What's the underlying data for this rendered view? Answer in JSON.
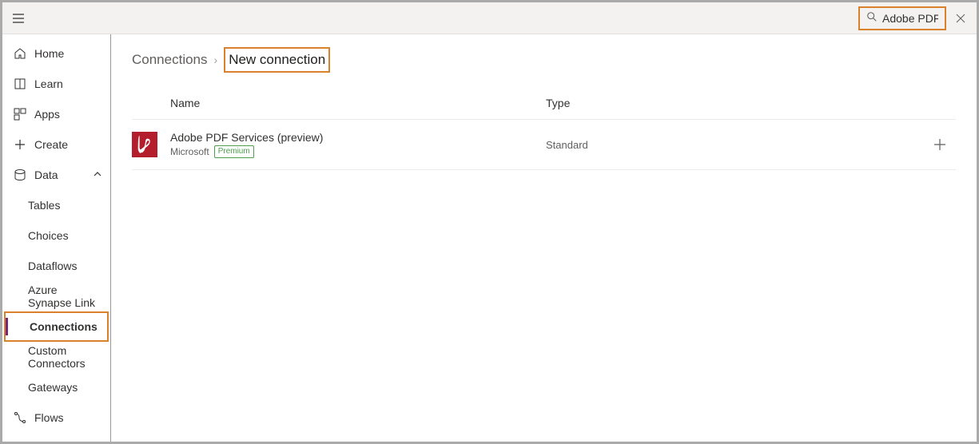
{
  "search": {
    "value": "Adobe PDF"
  },
  "sidebar": {
    "home": "Home",
    "learn": "Learn",
    "apps": "Apps",
    "create": "Create",
    "data": "Data",
    "tables": "Tables",
    "choices": "Choices",
    "dataflows": "Dataflows",
    "synapse": "Azure Synapse Link",
    "connections": "Connections",
    "custom": "Custom Connectors",
    "gateways": "Gateways",
    "flows": "Flows"
  },
  "breadcrumb": {
    "root": "Connections",
    "current": "New connection"
  },
  "table": {
    "headers": {
      "name": "Name",
      "type": "Type"
    },
    "row": {
      "title": "Adobe PDF Services (preview)",
      "publisher": "Microsoft",
      "badge": "Premium",
      "type": "Standard"
    }
  }
}
